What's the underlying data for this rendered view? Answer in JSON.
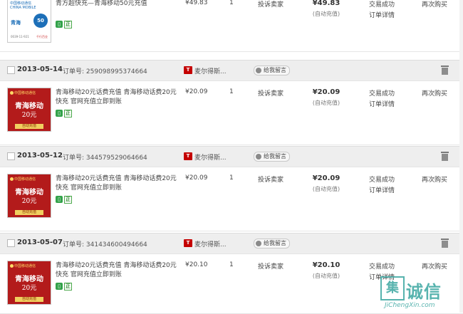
{
  "colors": {
    "accent": "#c40000",
    "header_bg": "#eeeeee",
    "watermark": "#3aa6a0"
  },
  "orders": [
    {
      "date": "",
      "order_no": "",
      "shop": "",
      "talk_label": "",
      "card_style": "white",
      "title": "青方超快充—青海移动50元充值",
      "price": "¥49.83",
      "qty": "1",
      "complain": "投诉卖家",
      "total": "¥49.83",
      "total_note": "(自动充值)",
      "status": "交易成功",
      "detail": "订单详情",
      "again": "再次购买",
      "card": {
        "logo": "中国移动通信",
        "logo2": "CHINA MOBILE",
        "cn": "青海",
        "amount": "50",
        "small": "0039-11-921",
        "small2": "千行百业"
      }
    },
    {
      "date": "2013-05-14",
      "order_no": "订单号: 259098995374664",
      "shop": "麦尔得斯...",
      "talk_label": "给我留言",
      "card_style": "red",
      "title": "青海移动20元话费充值 青海移动话费20元快充 官网充值立即到账",
      "price": "¥20.09",
      "qty": "1",
      "complain": "投诉卖家",
      "total": "¥20.09",
      "total_note": "(自动充值)",
      "status": "交易成功",
      "detail": "订单详情",
      "again": "再次购买",
      "card": {
        "logo": "中国移动通信",
        "cn": "青海移动",
        "amount": "20元",
        "strip": "自动充值"
      }
    },
    {
      "date": "2013-05-12",
      "order_no": "订单号: 344579529064664",
      "shop": "麦尔得斯...",
      "talk_label": "给我留言",
      "card_style": "red",
      "title": "青海移动20元话费充值 青海移动话费20元快充 官网充值立即到账",
      "price": "¥20.09",
      "qty": "1",
      "complain": "投诉卖家",
      "total": "¥20.09",
      "total_note": "(自动充值)",
      "status": "交易成功",
      "detail": "订单详情",
      "again": "再次购买",
      "card": {
        "logo": "中国移动通信",
        "cn": "青海移动",
        "amount": "20元",
        "strip": "自动充值"
      }
    },
    {
      "date": "2013-05-07",
      "order_no": "订单号: 341434600494664",
      "shop": "麦尔得斯...",
      "talk_label": "给我留言",
      "card_style": "red",
      "title": "青海移动20元话费充值 青海移动话费20元快充 官网充值立即到账",
      "price": "¥20.10",
      "qty": "1",
      "complain": "投诉卖家",
      "total": "¥20.10",
      "total_note": "(自动充值)",
      "status": "交易成功",
      "detail": "订单详情",
      "again": "再次购买",
      "card": {
        "logo": "中国移动通信",
        "cn": "青海移动",
        "amount": "20元",
        "strip": "自动充值"
      }
    }
  ],
  "badges": {
    "phone": "▯",
    "zheng": "正"
  },
  "watermark": {
    "char": "集",
    "text": "诚信",
    "url": "JiChengXin.com"
  }
}
